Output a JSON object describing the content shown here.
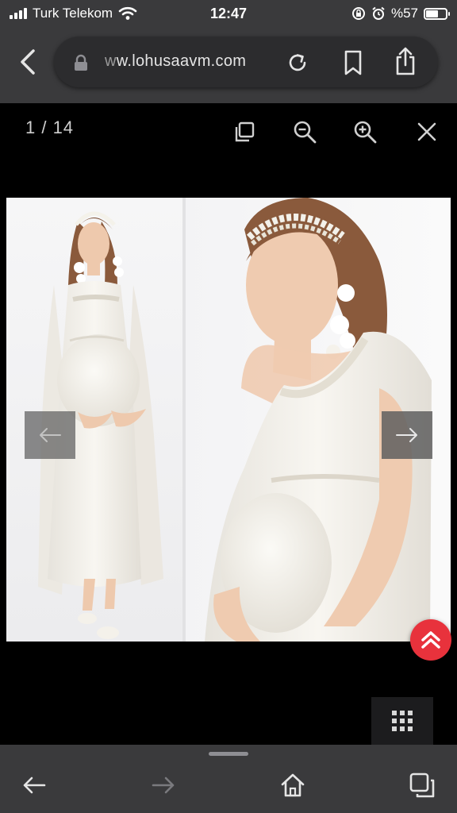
{
  "status": {
    "carrier": "Turk Telekom",
    "time": "12:47",
    "battery": "%57",
    "battery_level": 0.57,
    "icons": [
      "signal-icon",
      "wifi-icon",
      "rotation-lock-icon",
      "alarm-icon",
      "battery-icon"
    ]
  },
  "browser": {
    "url_faded": "w",
    "url_main": "w.lohusaavm.com",
    "icons": [
      "back-icon",
      "lock-icon",
      "reload-icon",
      "bookmark-icon",
      "share-icon"
    ]
  },
  "viewer": {
    "counter": "1 / 14",
    "current": 1,
    "total": 14,
    "icons": [
      "copy-icon",
      "zoom-out-icon",
      "zoom-in-icon",
      "close-icon",
      "arrow-left-icon",
      "arrow-right-icon",
      "grid-icon"
    ]
  },
  "fab": {
    "icon": "chevron-up-icon",
    "color": "#e8323c"
  },
  "bottom_bar": {
    "icons": [
      "back-arrow-icon",
      "forward-arrow-icon",
      "home-icon",
      "tabs-icon"
    ]
  }
}
